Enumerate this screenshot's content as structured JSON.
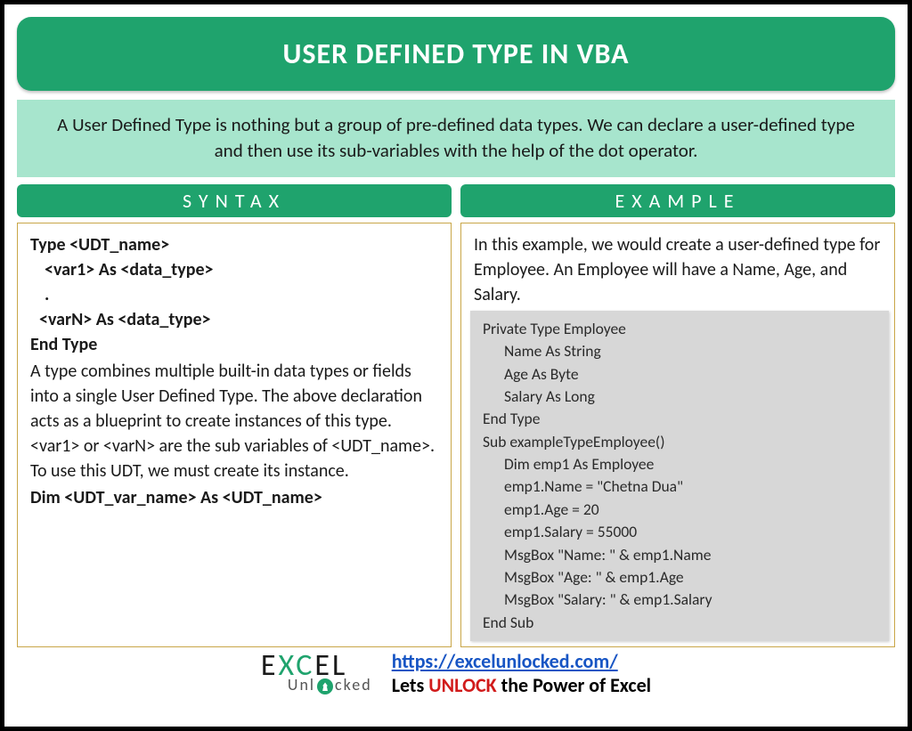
{
  "title": "USER DEFINED TYPE IN VBA",
  "intro": "A User Defined Type is nothing but a group of pre-defined data types. We can declare a user-defined type and then use its sub-variables with the help of the dot operator.",
  "sections": {
    "syntax": {
      "header": "SYNTAX",
      "code": {
        "l1": "Type <UDT_name>",
        "l2": "<var1> As <data_type>",
        "l3": ".",
        "l4": "<varN> As <data_type>",
        "l5": "End Type"
      },
      "desc": "A type combines multiple built-in data types or fields into a single User Defined Type. The above declaration acts as a blueprint to create instances of this type. <var1> or <varN> are the sub variables of <UDT_name>. To use this UDT, we must create its instance.",
      "dim": "Dim <UDT_var_name> As <UDT_name>"
    },
    "example": {
      "header": "EXAMPLE",
      "intro": "In this example, we would create a user-defined type for Employee. An Employee will have a Name, Age, and Salary.",
      "code": {
        "l1": "Private Type Employee",
        "l2": "Name As String",
        "l3": "Age As Byte",
        "l4": "Salary As Long",
        "l5": "End Type",
        "l6": "Sub exampleTypeEmployee()",
        "l7": "Dim emp1 As Employee",
        "l8": "emp1.Name = \"Chetna Dua\"",
        "l9": "emp1.Age = 20",
        "l10": "emp1.Salary = 55000",
        "l11": "MsgBox \"Name: \" & emp1.Name",
        "l12": "MsgBox \"Age: \" & emp1.Age",
        "l13": "MsgBox \"Salary: \" & emp1.Salary",
        "l14": "End Sub"
      }
    }
  },
  "footer": {
    "logo_top_prefix": "E",
    "logo_top_x": "X",
    "logo_top_c": "C",
    "logo_top_suffix": "EL",
    "logo_bottom_pre": "Unl",
    "logo_bottom_post": "cked",
    "url": "https://excelunlocked.com/",
    "tagline_pre": "Lets ",
    "tagline_unlock": "UNLOCK",
    "tagline_post": " the Power of Excel"
  }
}
